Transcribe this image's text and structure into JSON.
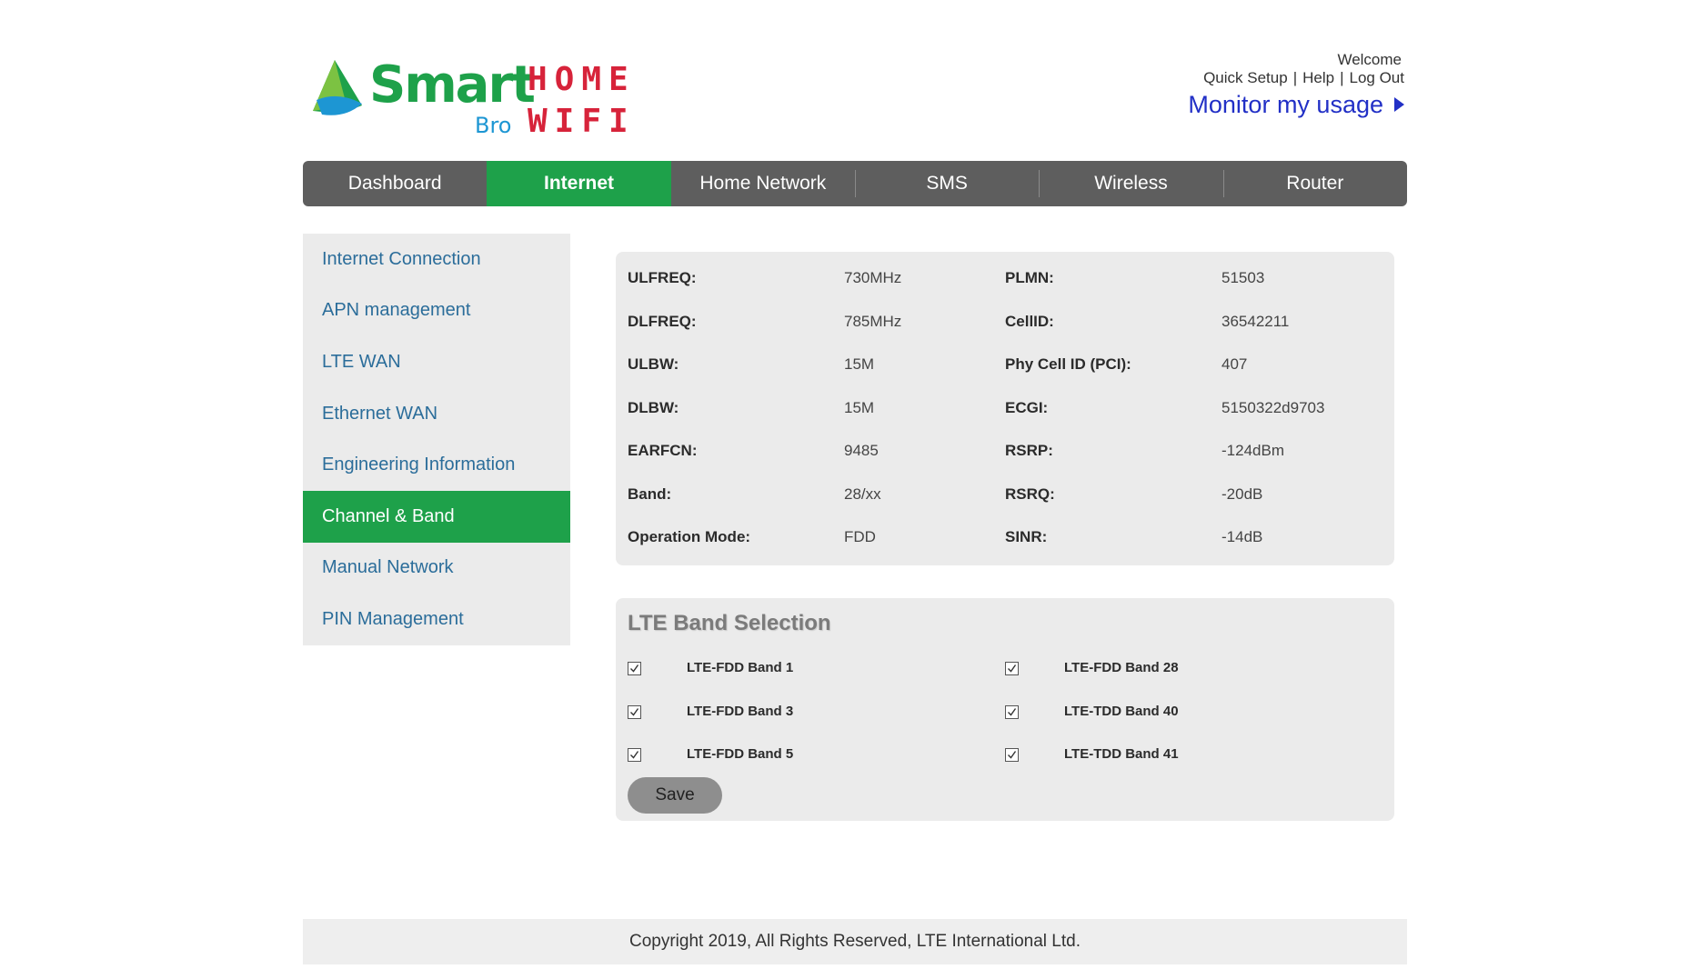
{
  "brand": {
    "smart": "Smart",
    "bro": "Bro",
    "home": "HOME",
    "wifi": "WIFI",
    "green": "#1ea14a",
    "red": "#d7233a",
    "blue": "#1d96d3"
  },
  "header": {
    "welcome": "Welcome",
    "quick_setup": "Quick Setup",
    "help": "Help",
    "logout": "Log Out",
    "separator": "|",
    "monitor": "Monitor my usage"
  },
  "nav": {
    "tabs": [
      {
        "label": "Dashboard"
      },
      {
        "label": "Internet",
        "active": true
      },
      {
        "label": "Home Network"
      },
      {
        "label": "SMS"
      },
      {
        "label": "Wireless"
      },
      {
        "label": "Router"
      }
    ]
  },
  "sidebar": {
    "items": [
      {
        "label": "Internet Connection"
      },
      {
        "label": "APN management"
      },
      {
        "label": "LTE WAN"
      },
      {
        "label": "Ethernet WAN"
      },
      {
        "label": "Engineering Information"
      },
      {
        "label": "Channel & Band",
        "active": true
      },
      {
        "label": "Manual Network"
      },
      {
        "label": "PIN Management"
      }
    ]
  },
  "info": {
    "rows": [
      {
        "l1": "ULFREQ:",
        "v1": "730MHz",
        "l2": "PLMN:",
        "v2": "51503"
      },
      {
        "l1": "DLFREQ:",
        "v1": "785MHz",
        "l2": "CellID:",
        "v2": "36542211"
      },
      {
        "l1": "ULBW:",
        "v1": "15M",
        "l2": "Phy Cell ID (PCI):",
        "v2": "407"
      },
      {
        "l1": "DLBW:",
        "v1": "15M",
        "l2": "ECGI:",
        "v2": "5150322d9703"
      },
      {
        "l1": "EARFCN:",
        "v1": "9485",
        "l2": "RSRP:",
        "v2": "-124dBm"
      },
      {
        "l1": "Band:",
        "v1": "28/xx",
        "l2": "RSRQ:",
        "v2": "-20dB"
      },
      {
        "l1": "Operation Mode:",
        "v1": "FDD",
        "l2": "SINR:",
        "v2": "-14dB"
      }
    ]
  },
  "bands": {
    "title": "LTE Band Selection",
    "items": [
      {
        "label": "LTE-FDD Band 1",
        "checked": true
      },
      {
        "label": "LTE-FDD Band 28",
        "checked": true
      },
      {
        "label": "LTE-FDD Band 3",
        "checked": true
      },
      {
        "label": "LTE-TDD Band 40",
        "checked": true
      },
      {
        "label": "LTE-FDD Band 5",
        "checked": true
      },
      {
        "label": "LTE-TDD Band 41",
        "checked": true
      }
    ],
    "save_label": "Save"
  },
  "footer": {
    "copyright": "Copyright 2019, All Rights Reserved, LTE International Ltd."
  }
}
